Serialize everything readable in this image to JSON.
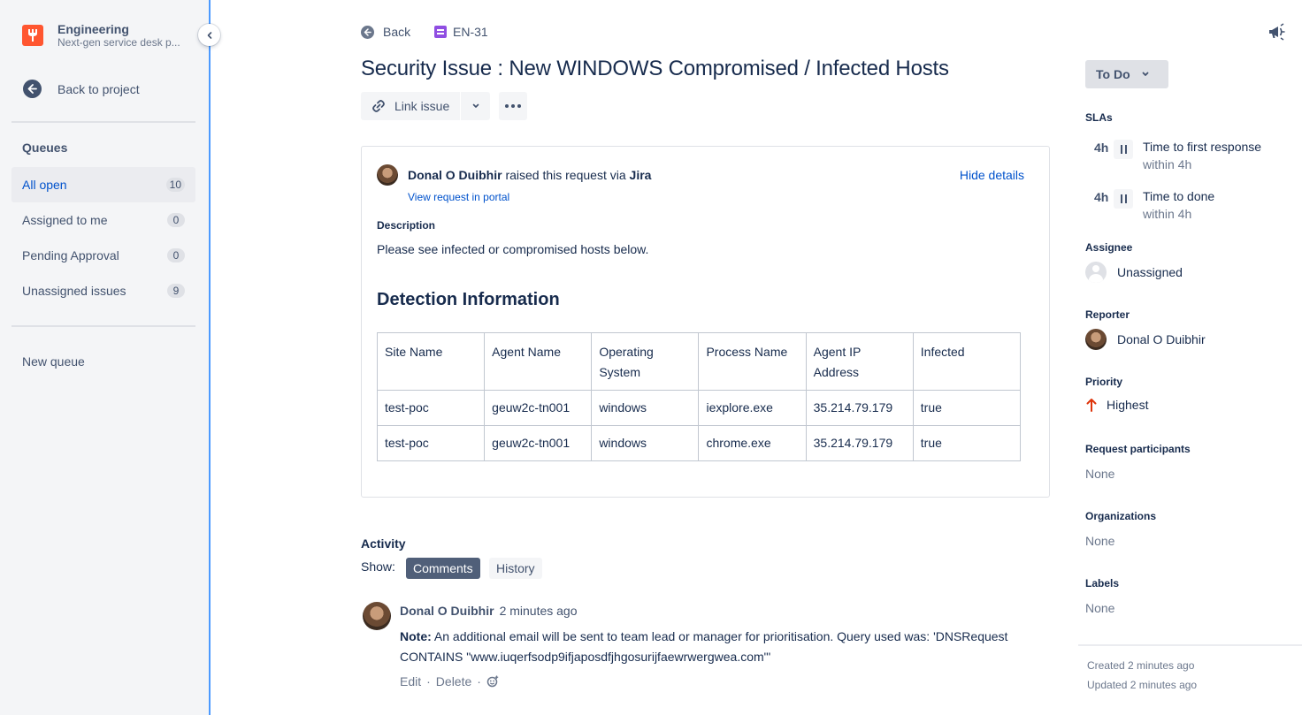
{
  "colors": {
    "accent": "#0052cc",
    "sidebar_bg": "#f4f5f7",
    "sidebar_border": "#4c9aff",
    "project_icon": "#ff5630",
    "issue_type": "#904ee2",
    "priority_highest": "#de350b",
    "comments_tab_bg": "#505f79"
  },
  "sidebar": {
    "project_name": "Engineering",
    "project_subtitle": "Next-gen service desk p...",
    "back_label": "Back to project",
    "queues_title": "Queues",
    "queues": [
      {
        "label": "All open",
        "count": "10",
        "active": true
      },
      {
        "label": "Assigned to me",
        "count": "0",
        "active": false
      },
      {
        "label": "Pending Approval",
        "count": "0",
        "active": false
      },
      {
        "label": "Unassigned issues",
        "count": "9",
        "active": false
      }
    ],
    "new_queue": "New queue"
  },
  "header": {
    "back_label": "Back",
    "issue_key": "EN-31",
    "title": "Security Issue : New WINDOWS Compromised / Infected Hosts",
    "link_issue_label": "Link issue"
  },
  "request": {
    "raiser_name": "Donal O Duibhir",
    "raised_text": " raised this request via ",
    "channel": "Jira",
    "view_portal": "View request in portal",
    "hide_details": "Hide details",
    "description_label": "Description",
    "description_text": "Please see infected or compromised hosts below.",
    "detection_title": "Detection Information",
    "table": {
      "headers": [
        "Site Name",
        "Agent Name",
        "Operating System",
        "Process Name",
        "Agent IP Address",
        "Infected"
      ],
      "rows": [
        [
          "test-poc",
          "geuw2c-tn001",
          "windows",
          "iexplore.exe",
          "35.214.79.179",
          "true"
        ],
        [
          "test-poc",
          "geuw2c-tn001",
          "windows",
          "chrome.exe",
          "35.214.79.179",
          "true"
        ]
      ]
    }
  },
  "activity": {
    "title": "Activity",
    "show_label": "Show:",
    "tabs": [
      "Comments",
      "History"
    ],
    "comment": {
      "author": "Donal O Duibhir",
      "time": "2 minutes ago",
      "note_label": "Note:",
      "body": " An additional email will be sent to team lead or manager for prioritisation. Query used was: 'DNSRequest CONTAINS \"www.iuqerfsodp9ifjaposdfjhgosurijfaewrwergwea.com\"'",
      "edit": "Edit",
      "delete": "Delete"
    }
  },
  "right_panel": {
    "status": "To Do",
    "slas_label": "SLAs",
    "slas": [
      {
        "time": "4h",
        "name": "Time to first response",
        "sub": "within 4h"
      },
      {
        "time": "4h",
        "name": "Time to done",
        "sub": "within 4h"
      }
    ],
    "assignee_label": "Assignee",
    "assignee": "Unassigned",
    "reporter_label": "Reporter",
    "reporter": "Donal O Duibhir",
    "priority_label": "Priority",
    "priority": "Highest",
    "participants_label": "Request participants",
    "participants": "None",
    "organizations_label": "Organizations",
    "organizations": "None",
    "labels_label": "Labels",
    "labels": "None",
    "created": "Created 2 minutes ago",
    "updated": "Updated 2 minutes ago"
  }
}
